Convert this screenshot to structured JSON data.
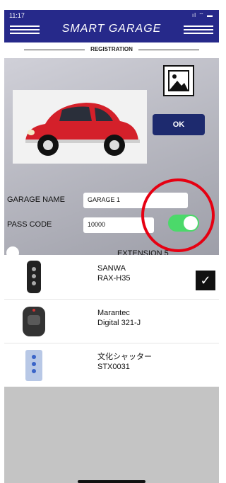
{
  "status_bar": {
    "time": "11:17",
    "signal": "ıl ⌔ ▬"
  },
  "app": {
    "title": "SMART GARAGE",
    "subtitle": "REGISTRATION"
  },
  "buttons": {
    "ok": "OK"
  },
  "form": {
    "garage_name_label": "GARAGE NAME",
    "garage_name_value": "GARAGE 1",
    "pass_code_label": "PASS CODE",
    "pass_code_value": "10000",
    "extension_label": "EXTENSION 5",
    "toggle_on": true
  },
  "remotes": [
    {
      "brand": "SANWA",
      "model": "RAX-H35",
      "selected": true
    },
    {
      "brand": "Marantec",
      "model": "Digital 321-J",
      "selected": false
    },
    {
      "brand": "文化シャッター",
      "model": "STX0031",
      "selected": false
    }
  ],
  "colors": {
    "header": "#26298a",
    "ok_button": "#1d2a6e",
    "toggle": "#4bd96a",
    "annotation": "#e60012"
  }
}
